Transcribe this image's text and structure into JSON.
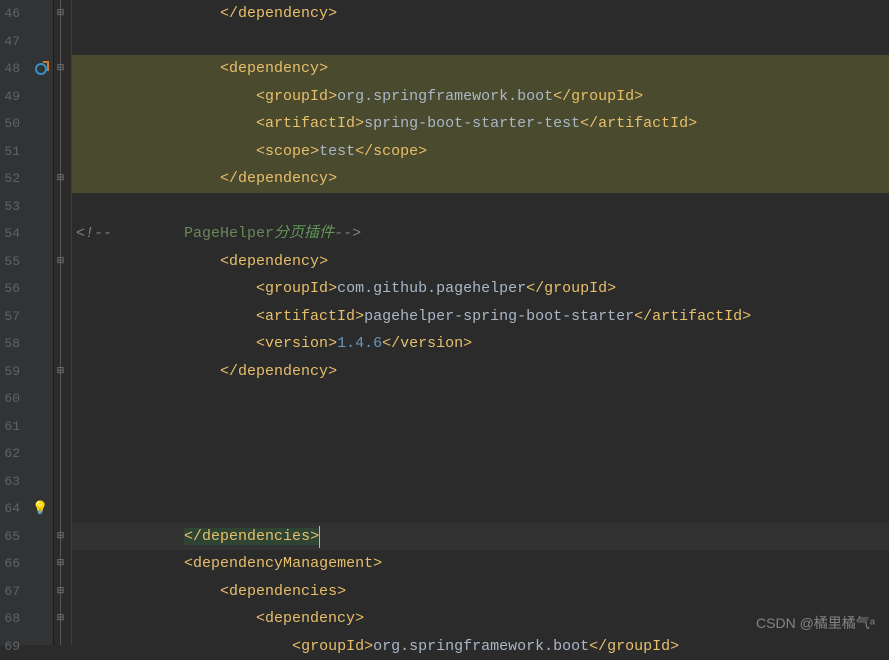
{
  "watermark": "CSDN @橘里橘气ᵃ",
  "lines": {
    "start": 46,
    "end": 69
  },
  "code": {
    "l46": {
      "indent": "                ",
      "close_tag": "dependency"
    },
    "l48": {
      "indent": "                ",
      "open_tag": "dependency"
    },
    "l49": {
      "indent": "                    ",
      "tag": "groupId",
      "value": "org.springframework.boot"
    },
    "l50": {
      "indent": "                    ",
      "tag": "artifactId",
      "value": "spring-boot-starter-test"
    },
    "l51": {
      "indent": "                    ",
      "tag": "scope",
      "value": "test"
    },
    "l52": {
      "indent": "                ",
      "close_tag": "dependency"
    },
    "l54": {
      "raw_open": "<!--        ",
      "kw": "PageHelper",
      "cjk": "分页插件",
      "raw_close": "-->"
    },
    "l55": {
      "indent": "                ",
      "open_tag": "dependency"
    },
    "l56": {
      "indent": "                    ",
      "tag": "groupId",
      "value": "com.github.pagehelper"
    },
    "l57": {
      "indent": "                    ",
      "tag": "artifactId",
      "value": "pagehelper-spring-boot-starter"
    },
    "l58": {
      "indent": "                    ",
      "tag": "version",
      "value": "1.4.6",
      "numeric": true
    },
    "l59": {
      "indent": "                ",
      "close_tag": "dependency"
    },
    "l65": {
      "indent": "            ",
      "close_tag": "dependencies"
    },
    "l66": {
      "indent": "            ",
      "open_tag": "dependencyManagement"
    },
    "l67": {
      "indent": "                ",
      "open_tag": "dependencies"
    },
    "l68": {
      "indent": "                    ",
      "open_tag": "dependency"
    },
    "l69": {
      "indent": "                        ",
      "tag": "groupId",
      "value": "org.springframework.boot"
    }
  },
  "icons": {
    "override": "override-icon",
    "bulb": "💡"
  }
}
